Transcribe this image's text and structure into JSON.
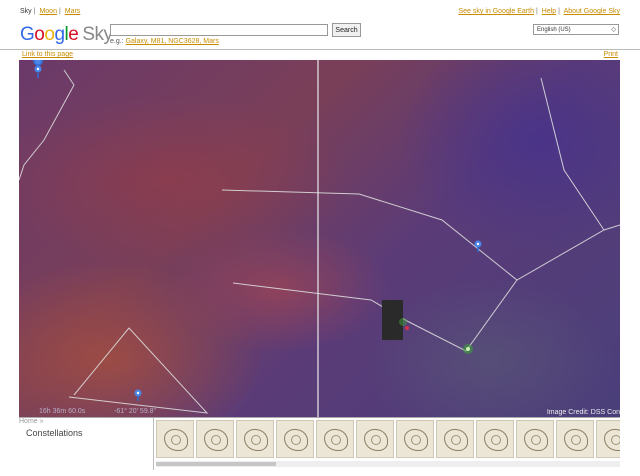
{
  "top_nav": {
    "sky": "Sky",
    "moon": "Moon",
    "mars": "Mars",
    "earth": "See sky in Google Earth",
    "help": "Help",
    "about": "About Google Sky"
  },
  "header": {
    "logo": [
      "G",
      "o",
      "o",
      "g",
      "l",
      "e"
    ],
    "product": "Sky",
    "search_value": "",
    "search_button": "Search",
    "hint_prefix": "e.g.:",
    "hint_examples": "Galaxy, M81, NGC3628, Mars",
    "language": "English (US)"
  },
  "subnav": {
    "link": "Link to this page",
    "print": "Print"
  },
  "map": {
    "ra_readout": "16h 36m 60.0s",
    "dec_readout": "-61° 20' 59.8\"",
    "credit": "Image Credit: DSS Con",
    "markers": [
      "placemark-icon",
      "placemark-icon",
      "placemark-icon"
    ],
    "colors": {
      "line": "#dcdcdc",
      "marker": "#4a86e8"
    }
  },
  "bottom": {
    "breadcrumb": "Home »",
    "section": "Constellations",
    "thumbnails": 12
  }
}
